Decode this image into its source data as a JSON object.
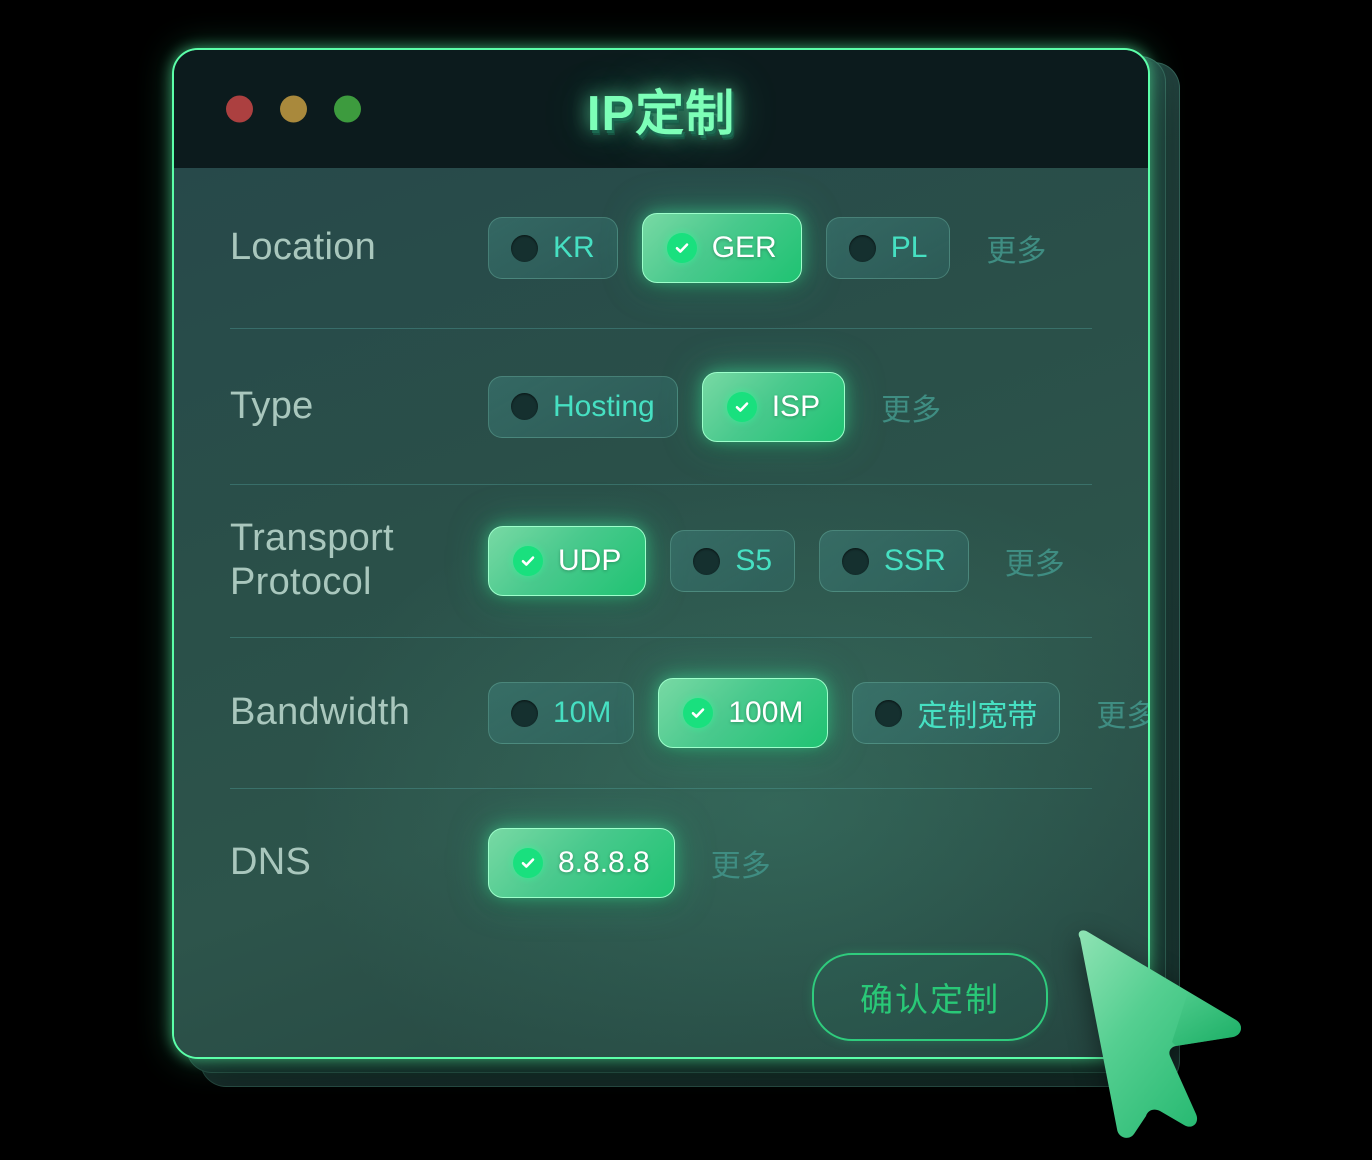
{
  "window": {
    "title": "IP定制",
    "traffic_lights": [
      {
        "name": "close",
        "color": "#ac4040"
      },
      {
        "name": "minimize",
        "color": "#a9893c"
      },
      {
        "name": "maximize",
        "color": "#3d9b3e"
      }
    ]
  },
  "theme": {
    "accent": "#2ecb7d",
    "accent_bright": "#5cffa9",
    "title_color": "#7dffb8",
    "label_color": "#a9c7bd",
    "pill_off_text": "#46e0c2",
    "more_text": "#3f8d82",
    "panel_bg": "#2a5049",
    "titlebar_bg": "#0c1b1d",
    "canvas_bg": "#000000"
  },
  "rows": [
    {
      "label": "Location",
      "more": "更多",
      "options": [
        {
          "label": "KR",
          "selected": false
        },
        {
          "label": "GER",
          "selected": true
        },
        {
          "label": "PL",
          "selected": false
        }
      ]
    },
    {
      "label": "Type",
      "more": "更多",
      "options": [
        {
          "label": "Hosting",
          "selected": false
        },
        {
          "label": "ISP",
          "selected": true
        }
      ]
    },
    {
      "label": "Transport Protocol",
      "more": "更多",
      "options": [
        {
          "label": "UDP",
          "selected": true
        },
        {
          "label": "S5",
          "selected": false
        },
        {
          "label": "SSR",
          "selected": false
        }
      ]
    },
    {
      "label": "Bandwidth",
      "more": "更多",
      "options": [
        {
          "label": "10M",
          "selected": false
        },
        {
          "label": "100M",
          "selected": true
        },
        {
          "label": "定制宽带",
          "selected": false
        }
      ]
    },
    {
      "label": "DNS",
      "more": "更多",
      "options": [
        {
          "label": "8.8.8.8",
          "selected": true
        }
      ]
    }
  ],
  "footer": {
    "confirm_label": "确认定制"
  },
  "cursor": {
    "icon": "arrow-pointer-3d",
    "color": "#3fc983"
  }
}
